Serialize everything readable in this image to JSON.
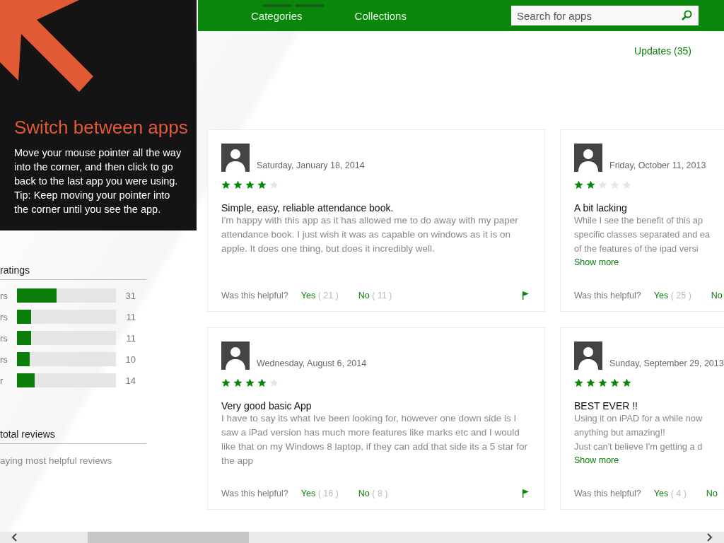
{
  "tip": {
    "title": "Switch between apps",
    "text": "Move your mouse pointer all the way into the corner, and then click to go back to the last app you were using.\nTip: Keep moving your pointer into the corner until you see the app."
  },
  "nav": {
    "tabs": [
      {
        "label": "Categories",
        "selected": false
      },
      {
        "label": "Collections",
        "selected": false
      }
    ],
    "search": {
      "placeholder": "Search for apps"
    }
  },
  "updates_link": "Updates (35)",
  "ratings": {
    "heading": "ratings",
    "rows": [
      {
        "label": "rs",
        "level": 0.4,
        "count": "31"
      },
      {
        "label": "rs",
        "level": 0.14,
        "count": "11"
      },
      {
        "label": "rs",
        "level": 0.14,
        "count": "11"
      },
      {
        "label": "rs",
        "level": 0.13,
        "count": "10"
      },
      {
        "label": "r",
        "level": 0.18,
        "count": "14"
      }
    ],
    "total_heading": "total reviews",
    "sort_note": "aying most helpful reviews"
  },
  "reviews": [
    {
      "date": "Saturday, January 18, 2014",
      "stars": 4,
      "title": "Simple, easy, reliable attendance book.",
      "body": [
        "I'm happy with this app as it has allowed me to do away with my paper attendance book. I just wish it was as capable on windows as it is on apple. It does one thing, but does it incredibly well."
      ],
      "show_more": false,
      "helpful": "Was this helpful?",
      "yes": "Yes",
      "yes_count": "( 21 )",
      "no": "No",
      "no_count": "( 11 )",
      "flag": true
    },
    {
      "date": "Friday, October 11, 2013",
      "stars": 2,
      "title": "A bit lacking",
      "body": [
        "While I see the benefit of this ap",
        "specific classes separated and ea",
        "of the features of the ipad versi"
      ],
      "show_more": "Show more",
      "helpful": "Was this helpful?",
      "yes": "Yes",
      "yes_count": "( 25 )",
      "no": "No",
      "flag": false
    },
    {
      "date": "Wednesday, August 6, 2014",
      "stars": 4,
      "title": "Very good basic App",
      "body": [
        "I have to say its what Ive been looking for, however one down side is I saw a iPad version has much more features like marks etc and I would like that on my Windows 8 laptop, if they can add that side its a 5 star for the app"
      ],
      "show_more": false,
      "helpful": "Was this helpful?",
      "yes": "Yes",
      "yes_count": "( 16 )",
      "no": "No",
      "no_count": "( 8 )",
      "flag": true
    },
    {
      "date": "Sunday, September 29, 2013",
      "stars": 5,
      "title": "BEST EVER !!",
      "body": [
        "Using it on iPAD for a while now",
        "anything but amazing!!",
        "Just can't believe I'm getting a d"
      ],
      "show_more": "Show more",
      "helpful": "Was this helpful?",
      "yes": "Yes",
      "yes_count": "( 4 )",
      "no": "No",
      "flag": false
    }
  ]
}
